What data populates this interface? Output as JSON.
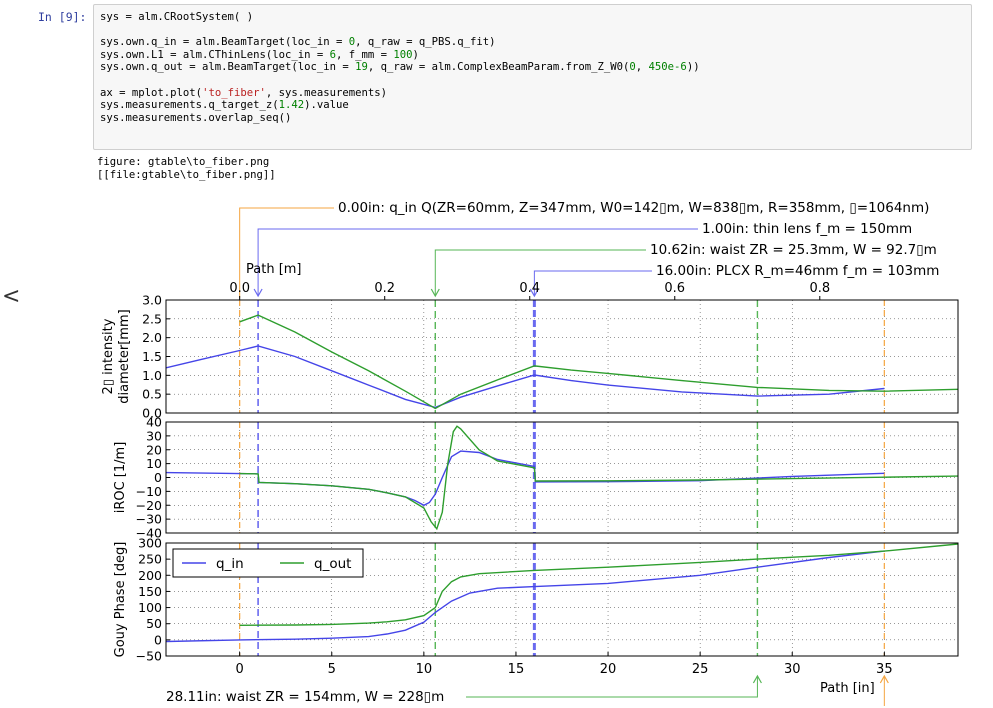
{
  "cell": {
    "prompt": "In [9]:",
    "code_lines": [
      "sys = alm.CRootSystem( )",
      "",
      "sys.own.q_in = alm.BeamTarget(loc_in = 0, q_raw = q_PBS.q_fit)",
      "sys.own.L1 = alm.CThinLens(loc_in = 6, f_mm = 100)",
      "sys.own.q_out = alm.BeamTarget(loc_in = 19, q_raw = alm.ComplexBeamParam.from_Z_W0(0, 450e-6))",
      "",
      "ax = mplot.plot('to_fiber', sys.measurements)",
      "sys.measurements.q_target_z(1.42).value",
      "sys.measurements.overlap_seq()"
    ],
    "output_lines": [
      "figure: gtable\\to_fiber.png",
      "[[file:gtable\\to_fiber.png]]"
    ]
  },
  "ui": {
    "collapse_glyph": "<"
  },
  "figure": {
    "annotations": [
      "0.00in: q_in Q(ZR=60mm, Z=347mm, W0=142▯m, W=838▯m, R=358mm, ▯=1064nm)",
      "1.00in: thin lens f_m = 150mm",
      "10.62in: waist ZR = 25.3mm, W = 92.7▯m",
      "16.00in: PLCX R_m=46mm f_m = 103mm",
      "28.11in: waist ZR = 154mm, W = 228▯m"
    ],
    "top_axis_label": "Path [m]",
    "top_ticks": [
      "0.0",
      "0.2",
      "0.4",
      "0.6",
      "0.8"
    ],
    "bottom_axis_label": "Path [in]",
    "bottom_ticks": [
      "0",
      "5",
      "10",
      "15",
      "20",
      "25",
      "30",
      "35"
    ],
    "legend": [
      "q_in",
      "q_out"
    ],
    "colors": {
      "q_in": "#4545e8",
      "q_out": "#2e9e2e",
      "orange": "#f5a540",
      "blue_light": "#6a6aef",
      "green_light": "#56b656"
    }
  },
  "chart_data": [
    {
      "type": "line",
      "title": "",
      "xlabel": "Path [in]",
      "ylabel": "2▯ intensity diameter[mm]",
      "xlim": [
        -4,
        39
      ],
      "ylim": [
        0,
        3
      ],
      "yticks": [
        "0.0",
        "0.5",
        "1.0",
        "1.5",
        "2.0",
        "2.5",
        "3.0"
      ],
      "grid": true,
      "vlines": [
        0,
        1,
        10.62,
        16,
        28.11,
        35
      ],
      "series": [
        {
          "name": "q_in",
          "x": [
            -4,
            -2,
            0,
            1,
            3,
            5,
            7,
            9,
            10.62,
            12,
            14,
            16,
            18,
            20,
            24,
            28.11,
            32,
            35
          ],
          "y": [
            1.2,
            1.43,
            1.66,
            1.78,
            1.5,
            1.12,
            0.74,
            0.36,
            0.15,
            0.42,
            0.72,
            1.01,
            0.86,
            0.74,
            0.56,
            0.45,
            0.5,
            0.65
          ]
        },
        {
          "name": "q_out",
          "x": [
            0,
            1,
            3,
            5,
            7,
            9,
            10.62,
            12,
            14,
            16,
            18,
            20,
            24,
            28.11,
            32,
            35,
            39
          ],
          "y": [
            2.42,
            2.6,
            2.15,
            1.62,
            1.12,
            0.58,
            0.12,
            0.5,
            0.88,
            1.25,
            1.14,
            1.05,
            0.86,
            0.68,
            0.6,
            0.58,
            0.63
          ]
        }
      ]
    },
    {
      "type": "line",
      "title": "",
      "xlabel": "Path [in]",
      "ylabel": "iROC [1/m]",
      "xlim": [
        -4,
        39
      ],
      "ylim": [
        -40,
        40
      ],
      "yticks": [
        "−40",
        "−30",
        "−20",
        "−10",
        "0",
        "10",
        "20",
        "30",
        "40"
      ],
      "grid": true,
      "vlines": [
        0,
        1,
        10.62,
        16,
        28.11,
        35
      ],
      "series": [
        {
          "name": "q_in",
          "x": [
            -4,
            0,
            1,
            1.05,
            3,
            5,
            7,
            8,
            9,
            9.5,
            10,
            10.3,
            10.62,
            11,
            11.5,
            12,
            13,
            14,
            16,
            16.05,
            20,
            25,
            30,
            35
          ],
          "y": [
            3.5,
            2.8,
            2.6,
            -3.5,
            -4.5,
            -6,
            -8.5,
            -11,
            -14,
            -16.5,
            -20,
            -18,
            -12,
            0,
            15,
            19,
            18,
            13,
            8,
            -3.2,
            -3.0,
            -2.3,
            0.8,
            3.0
          ]
        },
        {
          "name": "q_out",
          "x": [
            0,
            1,
            1.05,
            3,
            5,
            7,
            8,
            9,
            10,
            10.4,
            10.7,
            11,
            11.3,
            11.6,
            11.8,
            12,
            13,
            14,
            16,
            16.05,
            20,
            25,
            30,
            35,
            39
          ],
          "y": [
            2.8,
            2.6,
            -3.5,
            -4.5,
            -6,
            -8.5,
            -11,
            -14,
            -22,
            -32,
            -37,
            -25,
            10,
            33,
            37,
            35,
            20,
            12,
            7,
            -2.5,
            -2.4,
            -1.8,
            -0.8,
            0.2,
            1.0
          ]
        }
      ]
    },
    {
      "type": "line",
      "title": "",
      "xlabel": "Path [in]",
      "ylabel": "Gouy Phase [deg]",
      "xlim": [
        -4,
        39
      ],
      "ylim": [
        -50,
        300
      ],
      "yticks": [
        "−50",
        "0",
        "50",
        "100",
        "150",
        "200",
        "250",
        "300"
      ],
      "grid": true,
      "vlines": [
        0,
        1,
        10.62,
        16,
        28.11,
        35
      ],
      "series": [
        {
          "name": "q_in",
          "x": [
            -4,
            0,
            3,
            5,
            7,
            8,
            9,
            10,
            10.62,
            11.5,
            12.5,
            14,
            16,
            20,
            25,
            28.11,
            32,
            35
          ],
          "y": [
            -5,
            0,
            2,
            5,
            10,
            18,
            30,
            55,
            85,
            120,
            145,
            160,
            165,
            175,
            200,
            225,
            255,
            275
          ]
        },
        {
          "name": "q_out",
          "x": [
            0,
            3,
            5,
            7,
            8,
            9,
            10,
            10.62,
            11,
            11.5,
            12,
            13,
            16,
            20,
            25,
            28.11,
            32,
            35,
            39
          ],
          "y": [
            45,
            46,
            48,
            52,
            56,
            62,
            75,
            100,
            150,
            180,
            195,
            205,
            215,
            225,
            240,
            250,
            262,
            275,
            297
          ]
        }
      ]
    }
  ]
}
